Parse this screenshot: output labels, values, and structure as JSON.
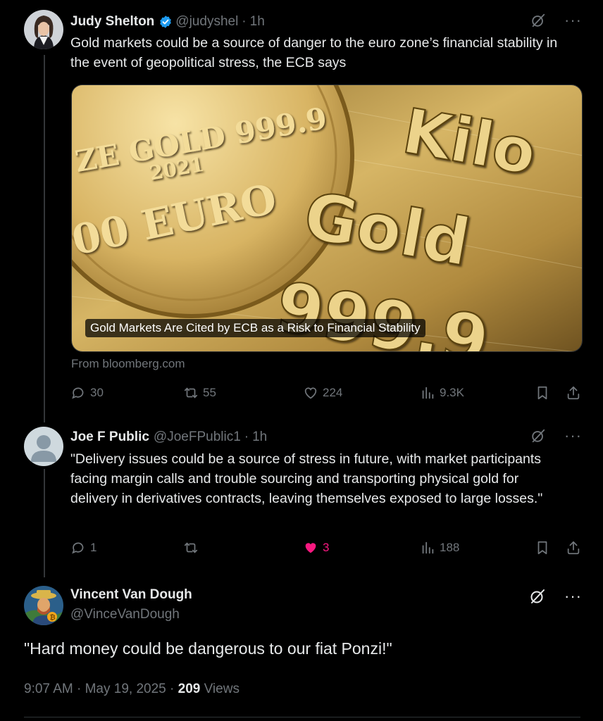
{
  "post1": {
    "name": "Judy Shelton",
    "handle": "@judyshel",
    "separator": "·",
    "time": "1h",
    "text": "Gold markets could be a source of danger to the euro zone’s financial stability in the event of geopolitical stress, the ECB says",
    "card": {
      "caption": "Gold Markets Are Cited by ECB as a Risk to Financial Stability",
      "source": "From bloomberg.com",
      "coin_lines": [
        "ZE GOLD 999.9",
        "2021",
        "00 EURO"
      ],
      "bar_lines": [
        "Kilo",
        "Gold",
        "999.9"
      ]
    },
    "actions": {
      "replies": "30",
      "reposts": "55",
      "likes": "224",
      "views": "9.3K"
    }
  },
  "post2": {
    "name": "Joe F Public",
    "handle": "@JoeFPublic1",
    "separator": "·",
    "time": "1h",
    "text": "\"Delivery issues could be a source of stress in future, with market participants facing margin calls and trouble sourcing and transporting physical gold for delivery in derivatives contracts, leaving themselves exposed to large losses.\"",
    "actions": {
      "replies": "1",
      "reposts": "",
      "likes": "3",
      "views": "188"
    }
  },
  "post3": {
    "name": "Vincent Van Dough",
    "handle": "@VinceVanDough",
    "text": "\"Hard money could be dangerous to our fiat Ponzi!\"",
    "timestamp": "9:07 AM · May 19, 2025 · ",
    "views_count": "209",
    "views_label": " Views"
  },
  "icons": [
    "verified-badge-icon",
    "grok-icon",
    "more-icon",
    "reply-icon",
    "repost-icon",
    "like-icon",
    "views-icon",
    "bookmark-icon",
    "share-icon"
  ],
  "colors": {
    "background": "#000000",
    "text": "#e7e9ea",
    "muted": "#71767b",
    "verified": "#1d9bf0",
    "like": "#f91880"
  }
}
